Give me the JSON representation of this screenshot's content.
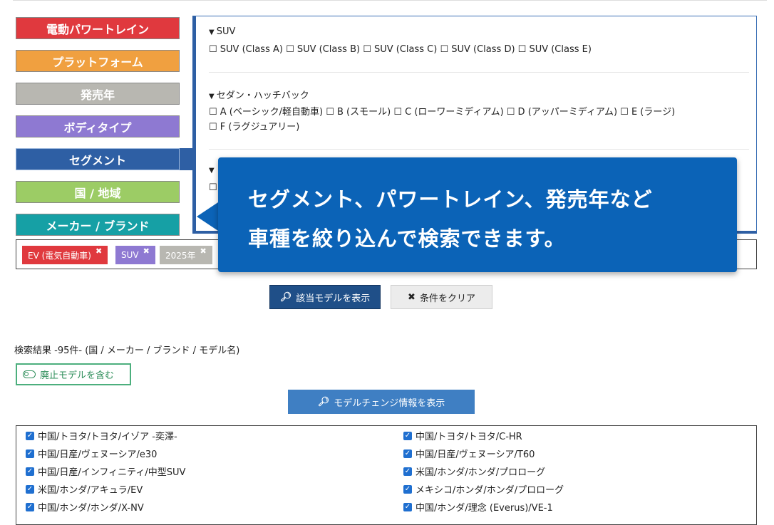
{
  "categories": [
    {
      "label": "電動パワートレイン",
      "color": "#e0393e"
    },
    {
      "label": "プラットフォーム",
      "color": "#f0a040"
    },
    {
      "label": "発売年",
      "color": "#b8b7b1"
    },
    {
      "label": "ボディタイプ",
      "color": "#8e79d2"
    },
    {
      "label": "セグメント",
      "color": "#2e5fa4"
    },
    {
      "label": "国 / 地域",
      "color": "#9ccc65"
    },
    {
      "label": "メーカー / ブランド",
      "color": "#16a0a5"
    }
  ],
  "panel": {
    "groups": [
      {
        "title": "SUV",
        "options": "☐ SUV (Class A) ☐ SUV (Class B) ☐ SUV (Class C) ☐ SUV (Class D) ☐ SUV (Class E)"
      },
      {
        "title": "セダン・ハッチバック",
        "options_line1": "☐ A (ベーシック/軽自動車) ☐ B (スモール) ☐ C (ローワーミディアム) ☐ D (アッパーミディアム) ☐ E (ラージ)",
        "options_line2": "☐ F (ラグジュアリー)"
      },
      {
        "title": "",
        "options": "☐"
      }
    ]
  },
  "chips": [
    {
      "label": "EV (電気自動車)",
      "color": "#e0393e"
    },
    {
      "label": "SUV",
      "color": "#8e79d2"
    },
    {
      "label": "2025年",
      "color": "#b8b7b1"
    }
  ],
  "chip_remove_glyph": "✖",
  "tooltip": {
    "line1": "セグメント、パワートレイン、発売年など",
    "line2": "車種を絞り込んで検索できます。"
  },
  "buttons": {
    "show_models": "該当モデルを表示",
    "clear": "条件をクリア",
    "include_discontinued": "廃止モデルを含む",
    "model_change": "モデルチェンジ情報を表示"
  },
  "results": {
    "title": "検索結果 -95件- (国 / メーカー / ブランド / モデル名)",
    "items_left": [
      "中国/トヨタ/トヨタ/イゾア -奕澤-",
      "中国/日産/ヴェヌーシア/e30",
      "中国/日産/インフィニティ/中型SUV",
      "米国/ホンダ/アキュラ/EV",
      "中国/ホンダ/ホンダ/X-NV"
    ],
    "items_right": [
      "中国/トヨタ/トヨタ/C-HR",
      "中国/日産/ヴェヌーシア/T60",
      "米国/ホンダ/ホンダ/プロローグ",
      "メキシコ/ホンダ/ホンダ/プロローグ",
      "中国/ホンダ/理念 (Everus)/VE-1"
    ]
  },
  "icons": {
    "search": "search-icon",
    "clear": "x-icon",
    "toggle": "toggle-icon",
    "checkbox": "checkbox-checked-icon"
  }
}
